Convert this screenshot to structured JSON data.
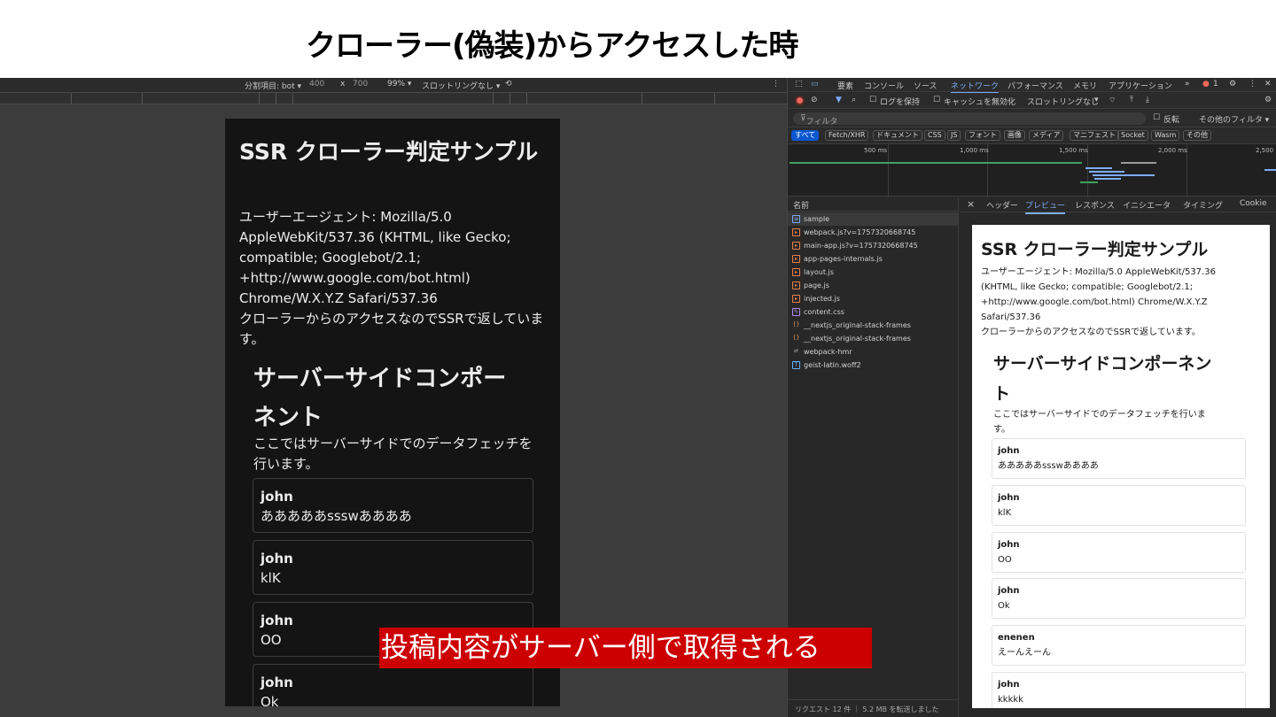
{
  "slide": {
    "title": "クローラー(偽装)からアクセスした時"
  },
  "device_toolbar": {
    "dimensions_label": "分割項目: bot ▾",
    "width": "400",
    "times": "x",
    "height": "700",
    "zoom": "99% ▾",
    "throttle": "スロットリングなし ▾"
  },
  "page": {
    "title": "SSR クローラー判定サンプル",
    "user_agent_lines": [
      "ユーザーエージェント: Mozilla/5.0",
      "AppleWebKit/537.36 (KHTML, like Gecko;",
      "compatible; Googlebot/2.1;",
      "+http://www.google.com/bot.html)",
      "Chrome/W.X.Y.Z Safari/537.36",
      "クローラーからのアクセスなのでSSRで返していま",
      "す。"
    ],
    "section_title_lines": [
      "サーバーサイドコンポー",
      "ネント"
    ],
    "section_desc_lines": [
      "ここではサーバーサイドでのデータフェッチを",
      "行います。"
    ],
    "posts": [
      {
        "author": "john",
        "body": "あああああssswああああ"
      },
      {
        "author": "john",
        "body": "klK"
      },
      {
        "author": "john",
        "body": "OO"
      },
      {
        "author": "john",
        "body": "Ok"
      }
    ]
  },
  "devtools": {
    "tabs": [
      "要素",
      "コンソール",
      "ソース",
      "ネットワーク",
      "パフォーマンス",
      "メモリ",
      "アプリケーション",
      "»"
    ],
    "error_count": "1",
    "toolbar": {
      "preserve_log": "ログを保持",
      "disable_cache": "キャッシュを無効化",
      "throttle": "スロットリングなし"
    },
    "filter": {
      "placeholder": "フィルタ",
      "invert": "反転",
      "more_filters": "その他のフィルタ ▾"
    },
    "type_chips": [
      "すべて",
      "Fetch/XHR",
      "ドキュメント",
      "CSS",
      "JS",
      "フォント",
      "画像",
      "メディア",
      "マニフェスト",
      "Socket",
      "Wasm",
      "その他"
    ],
    "timeline_labels": [
      "500 ms",
      "1,000 ms",
      "1,500 ms",
      "2,000 ms",
      "2,500"
    ],
    "name_header": "名前",
    "requests": [
      {
        "name": "sample",
        "type": "doc"
      },
      {
        "name": "webpack.js?v=1757320668745",
        "type": "js"
      },
      {
        "name": "main-app.js?v=1757320668745",
        "type": "js"
      },
      {
        "name": "app-pages-internals.js",
        "type": "js"
      },
      {
        "name": "layout.js",
        "type": "js"
      },
      {
        "name": "page.js",
        "type": "js"
      },
      {
        "name": "injected.js",
        "type": "js"
      },
      {
        "name": "content.css",
        "type": "css"
      },
      {
        "name": "__nextjs_original-stack-frames",
        "type": "fetch"
      },
      {
        "name": "__nextjs_original-stack-frames",
        "type": "fetch"
      },
      {
        "name": "webpack-hmr",
        "type": "ws"
      },
      {
        "name": "geist-latin.woff2",
        "type": "font"
      }
    ],
    "status": "リクエスト 12 件 ｜ 5.2 MB を転送しました",
    "detail_tabs": [
      "×",
      "ヘッダー",
      "プレビュー",
      "レスポンス",
      "イニシエータ",
      "タイミング",
      "Cookie"
    ],
    "preview": {
      "title": "SSR クローラー判定サンプル",
      "ua_lines": [
        "ユーザーエージェント: Mozilla/5.0 AppleWebKit/537.36",
        "(KHTML, like Gecko; compatible; Googlebot/2.1;",
        "+http://www.google.com/bot.html) Chrome/W.X.Y.Z",
        "Safari/537.36",
        "クローラーからのアクセスなのでSSRで返しています。"
      ],
      "section_title_lines": [
        "サーバーサイドコンポーネン",
        "ト"
      ],
      "section_desc_lines": [
        "ここではサーバーサイドでのデータフェッチを行いま",
        "す。"
      ],
      "posts": [
        {
          "author": "john",
          "body": "あああああssswああああ"
        },
        {
          "author": "john",
          "body": "klK"
        },
        {
          "author": "john",
          "body": "OO"
        },
        {
          "author": "john",
          "body": "Ok"
        },
        {
          "author": "enenen",
          "body": "えーんえーん"
        },
        {
          "author": "john",
          "body": "kkkkk"
        }
      ]
    }
  },
  "overlay": {
    "caption": "投稿内容がサーバー側で取得される",
    "color": "#cc0000"
  }
}
